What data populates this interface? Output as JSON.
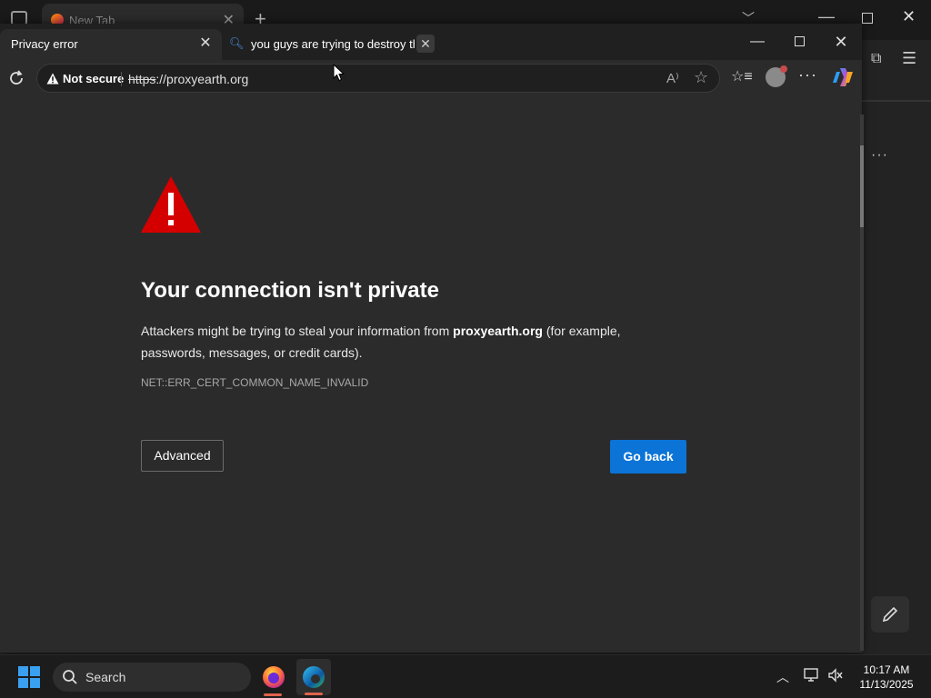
{
  "background_window": {
    "tab_label": "New Tab"
  },
  "window": {
    "tabs": [
      {
        "label": "Privacy error",
        "active": true
      },
      {
        "label": "you guys are trying to destroy th",
        "active": false
      }
    ]
  },
  "toolbar": {
    "security_label": "Not secure",
    "url_scheme": "https",
    "url_rest": "://proxyearth.org"
  },
  "page": {
    "title": "Your connection isn't private",
    "desc_prefix": "Attackers might be trying to steal your information from ",
    "desc_domain": "proxyearth.org",
    "desc_suffix": " (for example, passwords, messages, or credit cards).",
    "error_code": "NET::ERR_CERT_COMMON_NAME_INVALID",
    "advanced_label": "Advanced",
    "go_back_label": "Go back"
  },
  "colors": {
    "accent": "#0b74d6",
    "warning": "#d40000"
  },
  "taskbar": {
    "search_label": "Search",
    "time": "10:17 AM",
    "date": "11/13/2025"
  }
}
